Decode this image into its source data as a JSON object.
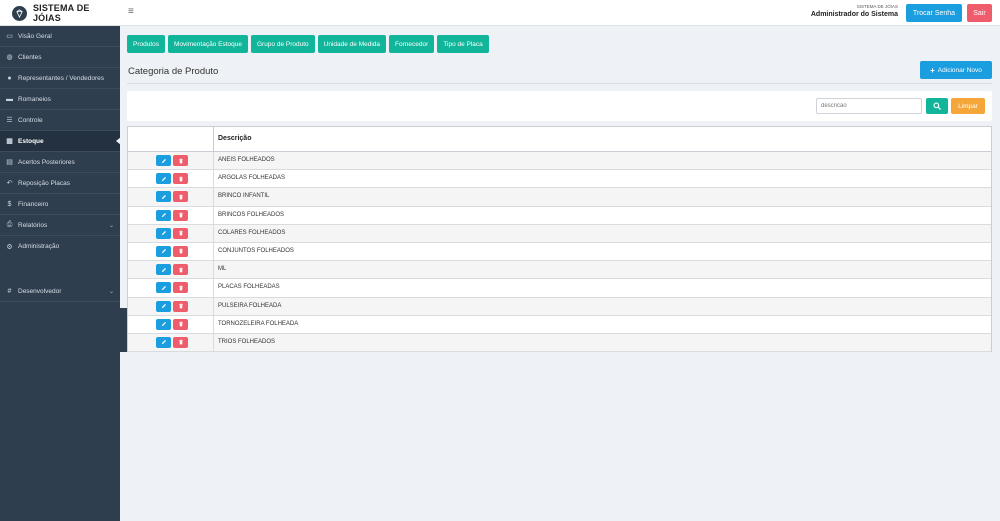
{
  "header": {
    "brand_title": "SISTEMA DE JÓIAS",
    "menu_icon": "≡",
    "user_system": "SISTEMA DE JÓIAS",
    "user_name": "Administrador do Sistema",
    "change_password_label": "Trocar Senha",
    "logout_label": "Sair"
  },
  "sidebar": {
    "items": [
      {
        "label": "Visão Geral",
        "icon": "monitor-icon",
        "glyph": "▭"
      },
      {
        "label": "Clientes",
        "icon": "users-icon",
        "glyph": "👥"
      },
      {
        "label": "Representantes / Vendedores",
        "icon": "user-tie-icon",
        "glyph": "●"
      },
      {
        "label": "Romaneios",
        "icon": "briefcase-icon",
        "glyph": "▬"
      },
      {
        "label": "Controle",
        "icon": "list-icon",
        "glyph": "☰"
      },
      {
        "label": "Estoque",
        "icon": "grid-icon",
        "glyph": "▦"
      },
      {
        "label": "Acertos Posteriores",
        "icon": "calendar-icon",
        "glyph": "▤"
      },
      {
        "label": "Reposição Placas",
        "icon": "reply-icon",
        "glyph": "↶"
      },
      {
        "label": "Financeiro",
        "icon": "dollar-icon",
        "glyph": "$"
      },
      {
        "label": "Relatórios",
        "icon": "print-icon",
        "glyph": "⎙"
      },
      {
        "label": "Administração",
        "icon": "gear-icon",
        "glyph": "⚙"
      },
      {
        "label": "Desenvolvedor",
        "icon": "hash-icon",
        "glyph": "#"
      }
    ],
    "active": "Estoque"
  },
  "tabs": [
    "Produtos",
    "Movimentação Estoque",
    "Grupo de Produto",
    "Unidade de Medida",
    "Fornecedor",
    "Tipo de Placa"
  ],
  "page": {
    "title": "Categoria de Produto",
    "add_label": "Adicionar Novo"
  },
  "filter": {
    "search_placeholder": "descricao",
    "clear_label": "Limpar"
  },
  "table": {
    "column_description": "Descrição",
    "rows": [
      "ANEIS FOLHEADOS",
      "ARGOLAS FOLHEADAS",
      "BRINCO INFANTIL",
      "BRINCOS FOLHEADOS",
      "COLARES FOLHEADOS",
      "CONJUNTOS FOLHEADOS",
      "ML",
      "PLACAS FOLHEADAS",
      "PULSEIRA FOLHEADA",
      "TORNOZELEIRA FOLHEADA",
      "TRIOS FOLHEADOS"
    ]
  },
  "colors": {
    "sidebar": "#2f3e4e",
    "primary": "#1b9ee0",
    "success": "#10b59a",
    "danger": "#ef5d6c",
    "warning": "#f4a638"
  }
}
